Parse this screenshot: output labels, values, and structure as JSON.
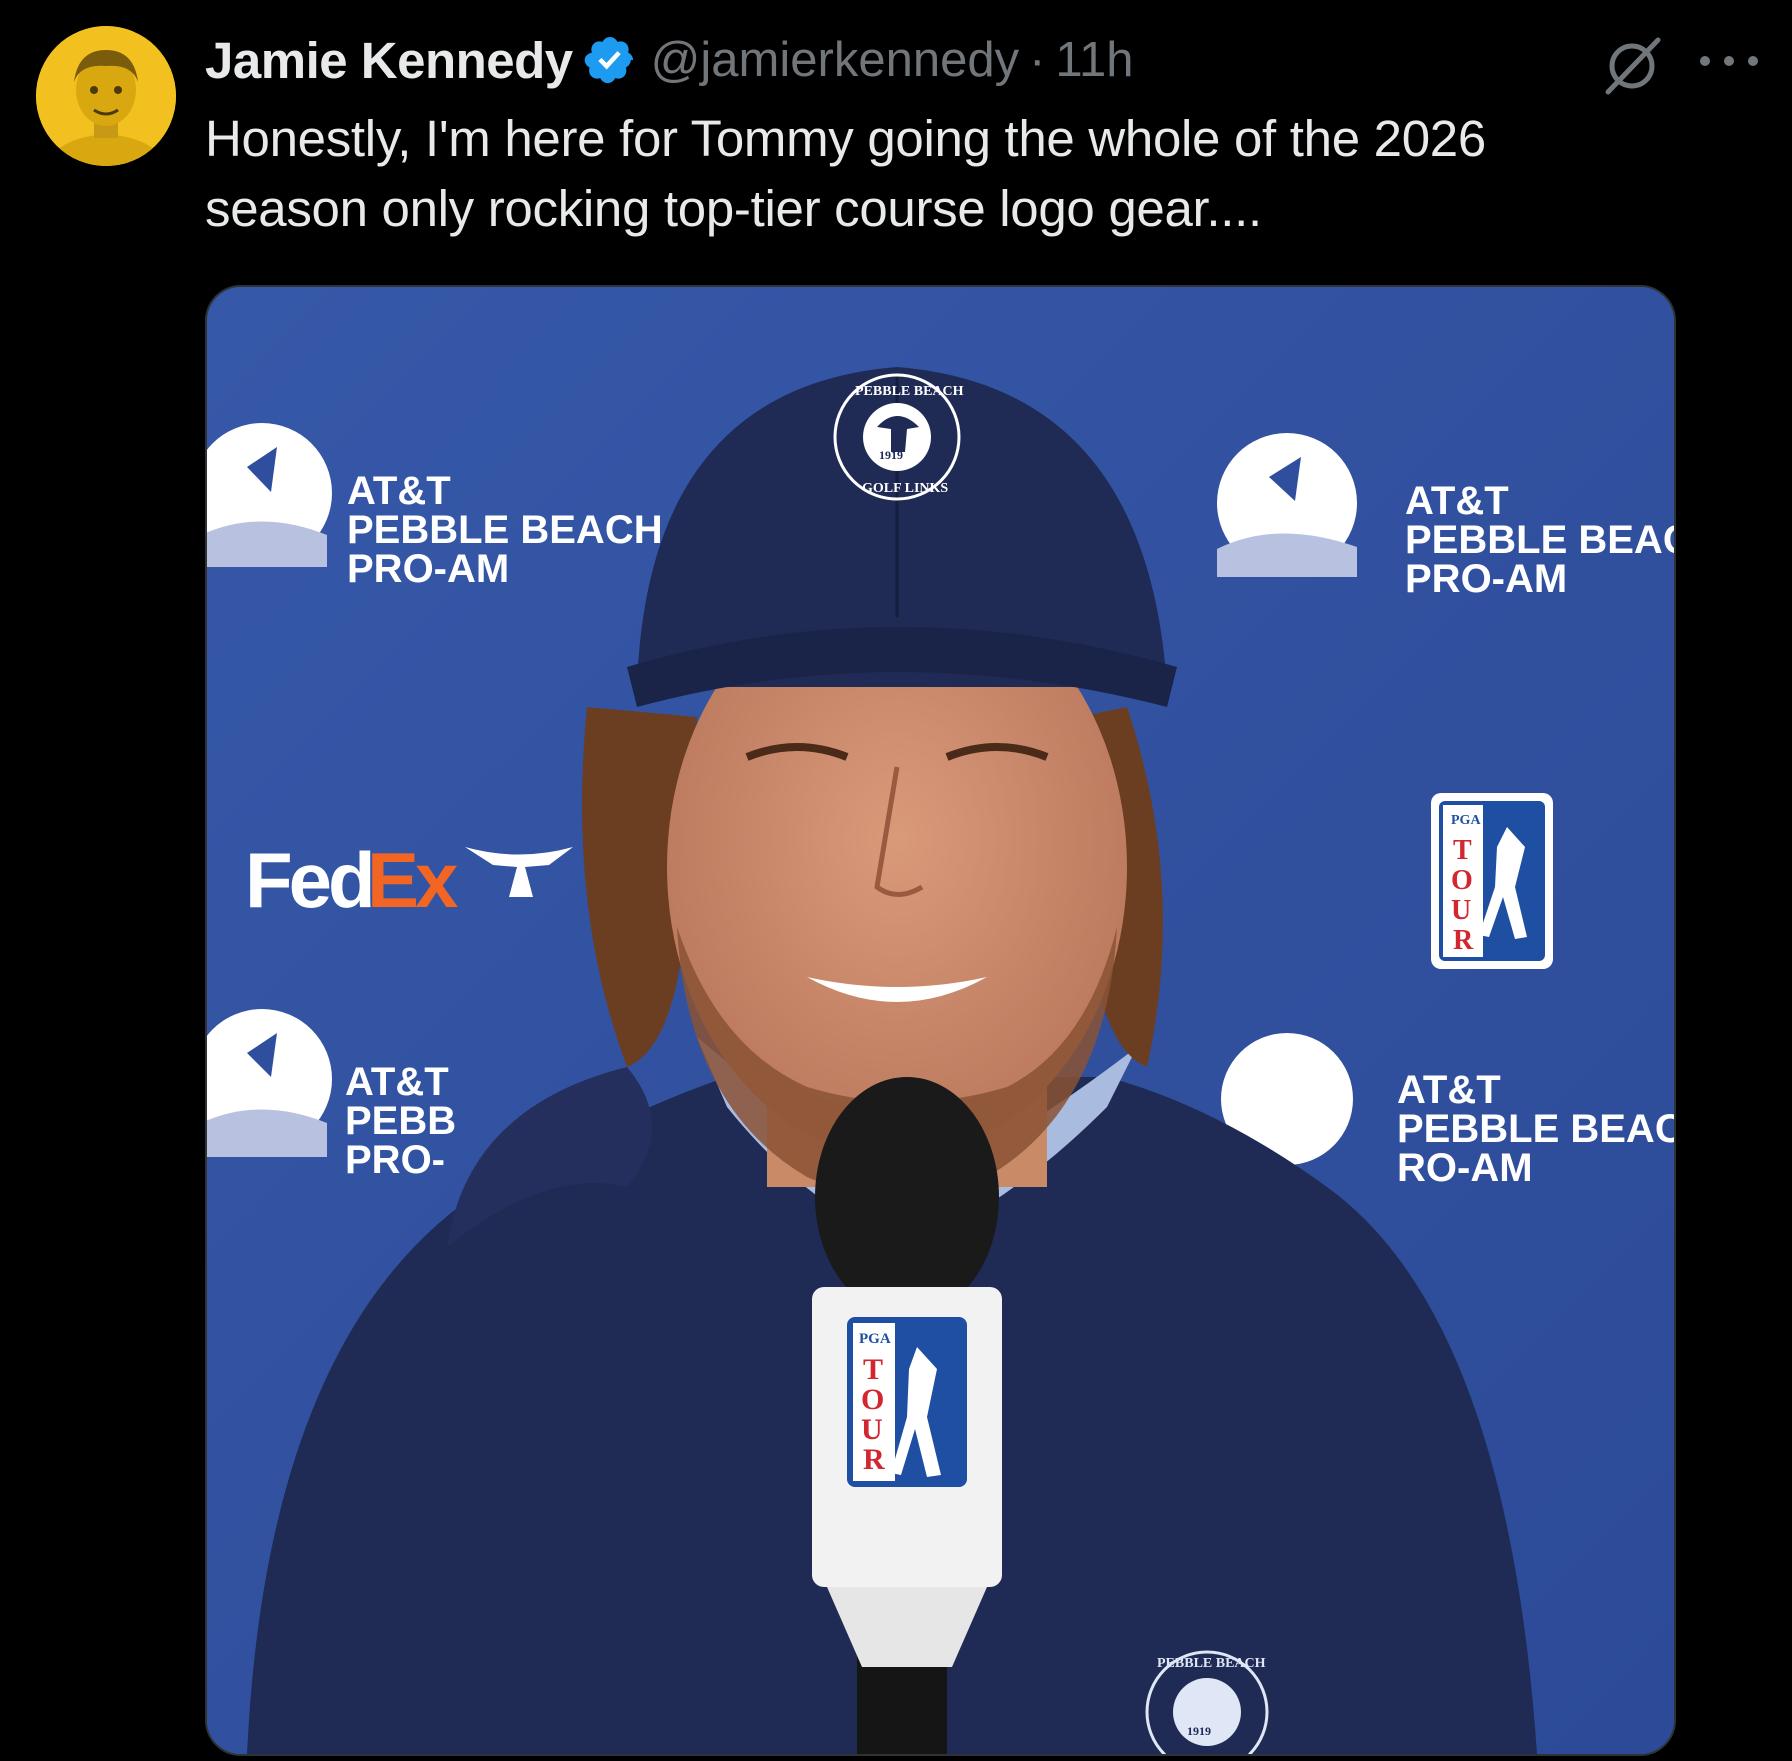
{
  "author": {
    "display_name": "Jamie Kennedy",
    "handle": "@jamierkennedy",
    "separator": "·",
    "time": "11h",
    "verified": true
  },
  "tweet": {
    "text": "Honestly, I'm here for Tommy going the whole of the 2026 season only rocking top-tier course logo gear...."
  },
  "icons": {
    "avatar": "avatar",
    "verified": "verified-badge-icon",
    "grok": "grok-icon",
    "more": "more-icon"
  },
  "media": {
    "backdrop": {
      "sponsor_1": "AT&T",
      "sponsor_2": "PEBBLE BEACH",
      "sponsor_3": "PRO-AM",
      "sponsor_2_cut_right": "PEBBLE BEAC",
      "sponsor_2_cut_left": "PEBB",
      "sponsor_3_cut_left": "PRO-",
      "sponsor_3_cut_bottom": "RO-AM",
      "fedex_fed": "Fed",
      "fedex_ex": "Ex",
      "pga": "PGA",
      "tour_letters": [
        "T",
        "O",
        "U",
        "R"
      ]
    },
    "cap_logo_top": "PEBBLE BEACH",
    "cap_logo_bottom": "GOLF LINKS",
    "cap_logo_year": "1919",
    "colors": {
      "backdrop": "#2f4e9e",
      "navy": "#1f2a55",
      "fedex_purple": "#ffffff",
      "fedex_orange": "#f26522",
      "tour_red": "#d22630",
      "pga_blue": "#1e4fa3"
    }
  }
}
